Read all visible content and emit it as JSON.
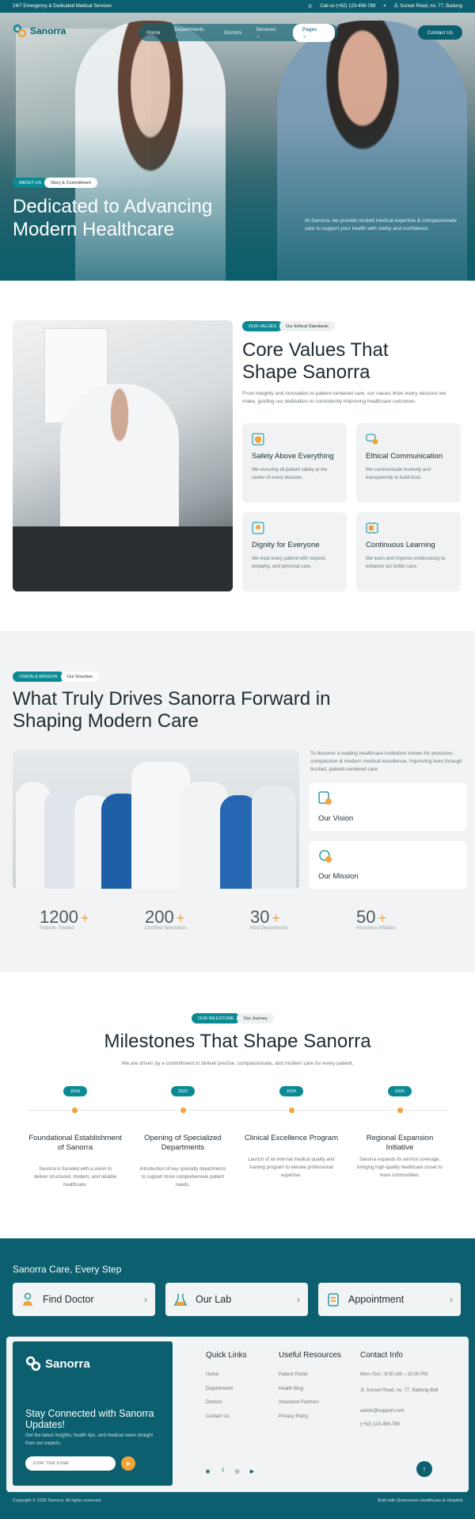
{
  "topbar": {
    "left": "24/7 Emergency & Dedicated Medical Services",
    "phone": "Call us (+62) 123-456-789",
    "address": "Jl. Sunset Road, no. 77, Badung"
  },
  "brand": {
    "name": "Sanorra",
    "accent": "#0b5f6e",
    "accent_light": "#0b8a94",
    "highlight": "#f2a33a"
  },
  "nav": {
    "items": [
      "Home",
      "Departments",
      "Doctors",
      "Services",
      "Pages"
    ],
    "active": "Pages",
    "contact_label": "Contact Us"
  },
  "hero": {
    "pill_dark": "ABOUT US",
    "pill_light": "Story & Commitment",
    "title": "Dedicated to Advancing Modern Healthcare",
    "desc": "At Sanorra, we provide trusted medical expertise & compassionate care to support your health with clarity and confidence."
  },
  "values": {
    "pill_dark": "OUR VALUES",
    "pill_light": "Our Ethical Standards",
    "title": "Core Values That Shape Sanorra",
    "desc": "From integrity and innovation to patient-centered care, our values drive every decision we make, guiding our dedication to consistently improving healthcare outcomes.",
    "cards": [
      {
        "icon": "shield-icon",
        "title": "Safety Above Everything",
        "text": "We ensuring all patient safety at the center of every decision."
      },
      {
        "icon": "chat-icon",
        "title": "Ethical Communication",
        "text": "We communicate honestly and transparently to build trust."
      },
      {
        "icon": "heart-hand-icon",
        "title": "Dignity for Everyone",
        "text": "We treat every patient with respect, empathy, and personal care."
      },
      {
        "icon": "book-icon",
        "title": "Continuous Learning",
        "text": "We learn and improve continuously to enhance our better care."
      }
    ]
  },
  "vision": {
    "pill_dark": "VISION & MISSION",
    "pill_light": "Our Direction",
    "title": "What Truly Drives Sanorra Forward in Shaping Modern Care",
    "desc": "To become a leading healthcare institution known for precision, compassion & modern medical excellence, improving lives through trusted, patient-centered care.",
    "cards": [
      {
        "icon": "vision-icon",
        "title": "Our Vision"
      },
      {
        "icon": "mission-icon",
        "title": "Our Mission"
      }
    ],
    "stats": [
      {
        "value": "1200",
        "label": "Patients Treated"
      },
      {
        "value": "200",
        "label": "Certified Specialists"
      },
      {
        "value": "30",
        "label": "Med Departments"
      },
      {
        "value": "50",
        "label": "Insurance Affiliates"
      }
    ]
  },
  "milestones": {
    "pill_dark": "OUR MILESTONE",
    "pill_light": "Our Journey",
    "title": "Milestones That Shape Sanorra",
    "sub": "We are driven by a commitment to deliver precise, compassionate, and modern care for every patient.",
    "items": [
      {
        "year": "2018",
        "title": "Foundational Establishment of Sanorra",
        "text": "Sanorra is founded with a vision to deliver structured, modern, and reliable healthcare."
      },
      {
        "year": "2022",
        "title": "Opening of Specialized Departments",
        "text": "Introduction of key specialty departments to support more comprehensive patient needs."
      },
      {
        "year": "2024",
        "title": "Clinical Excellence Program",
        "text": "Launch of an internal medical quality and training program to elevate professional expertise."
      },
      {
        "year": "2025",
        "title": "Regional Expansion Initiative",
        "text": "Sanorra expands its service coverage, bringing high-quality healthcare closer to more communities."
      }
    ]
  },
  "footer": {
    "care_title": "Sanorra Care, Every Step",
    "quick_cards": [
      {
        "icon": "doctor-icon",
        "label": "Find Doctor"
      },
      {
        "icon": "lab-icon",
        "label": "Our Lab"
      },
      {
        "icon": "clipboard-icon",
        "label": "Appointment"
      }
    ],
    "newsletter": {
      "title": "Stay Connected with Sanorra Updates!",
      "text": "Get the latest insights, health tips, and medical news straight from our experts.",
      "placeholder": "Enter Your Email"
    },
    "quick_links": {
      "title": "Quick Links",
      "items": [
        "Home",
        "Departments",
        "Doctors",
        "Contact Us"
      ]
    },
    "resources": {
      "title": "Useful Resources",
      "items": [
        "Patient Portal",
        "Health Blog",
        "Insurance Partners",
        "Privacy Policy"
      ]
    },
    "contact": {
      "title": "Contact Info",
      "hours": "Mon–Sun : 8:00 AM – 10:00 PM",
      "address": "Jl. Sunset Road, no. 77, Badung-Bali",
      "email": "admin@support.com",
      "phone": "(+62) 123-456-789"
    },
    "copyright": "Copyright © 2025 Sanorra. All rights reserved.",
    "built": "Built with Qutenverse Healthcare & Hospital"
  }
}
